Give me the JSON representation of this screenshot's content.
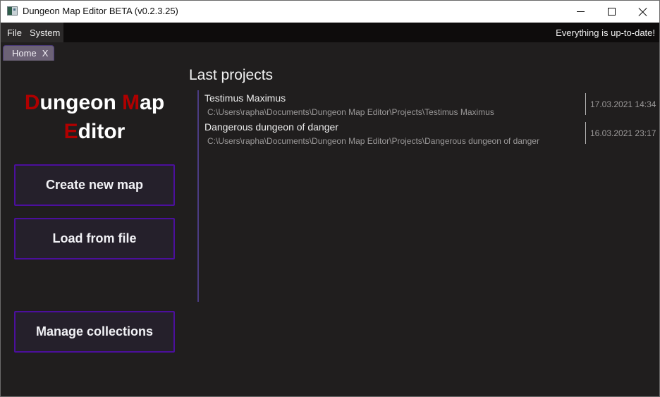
{
  "window": {
    "title": "Dungeon Map Editor BETA (v0.2.3.25)",
    "icon": "app-icon",
    "controls": {
      "minimize_icon": "minimize-icon",
      "maximize_icon": "maximize-icon",
      "close_icon": "close-icon"
    }
  },
  "menubar": {
    "items": [
      {
        "label": "File"
      },
      {
        "label": "System"
      }
    ],
    "status": "Everything is up-to-date!"
  },
  "tabs": [
    {
      "label": "Home",
      "close_label": "X",
      "active": true
    }
  ],
  "logo": {
    "line1": [
      {
        "text": "D",
        "accent": true
      },
      {
        "text": "ungeon ",
        "accent": false
      },
      {
        "text": "M",
        "accent": true
      },
      {
        "text": "ap",
        "accent": false
      }
    ],
    "line2": [
      {
        "text": "E",
        "accent": true
      },
      {
        "text": "ditor",
        "accent": false
      }
    ],
    "accent_color": "#b00000"
  },
  "actions": {
    "create_label": "Create new map",
    "load_label": "Load from file",
    "manage_label": "Manage collections",
    "border_color": "#4b0f9c"
  },
  "last_projects": {
    "title": "Last projects",
    "items": [
      {
        "name": "Testimus Maximus",
        "path": "C:\\Users\\rapha\\Documents\\Dungeon Map Editor\\Projects\\Testimus Maximus",
        "date": "17.03.2021 14:34"
      },
      {
        "name": "Dangerous dungeon of danger",
        "path": "C:\\Users\\rapha\\Documents\\Dungeon Map Editor\\Projects\\Dangerous dungeon of danger",
        "date": "16.03.2021 23:17"
      }
    ]
  },
  "colors": {
    "background": "#201e1e",
    "menubar": "#0e0c0c",
    "tab": "#6c6276",
    "rail": "#4a3b82"
  }
}
